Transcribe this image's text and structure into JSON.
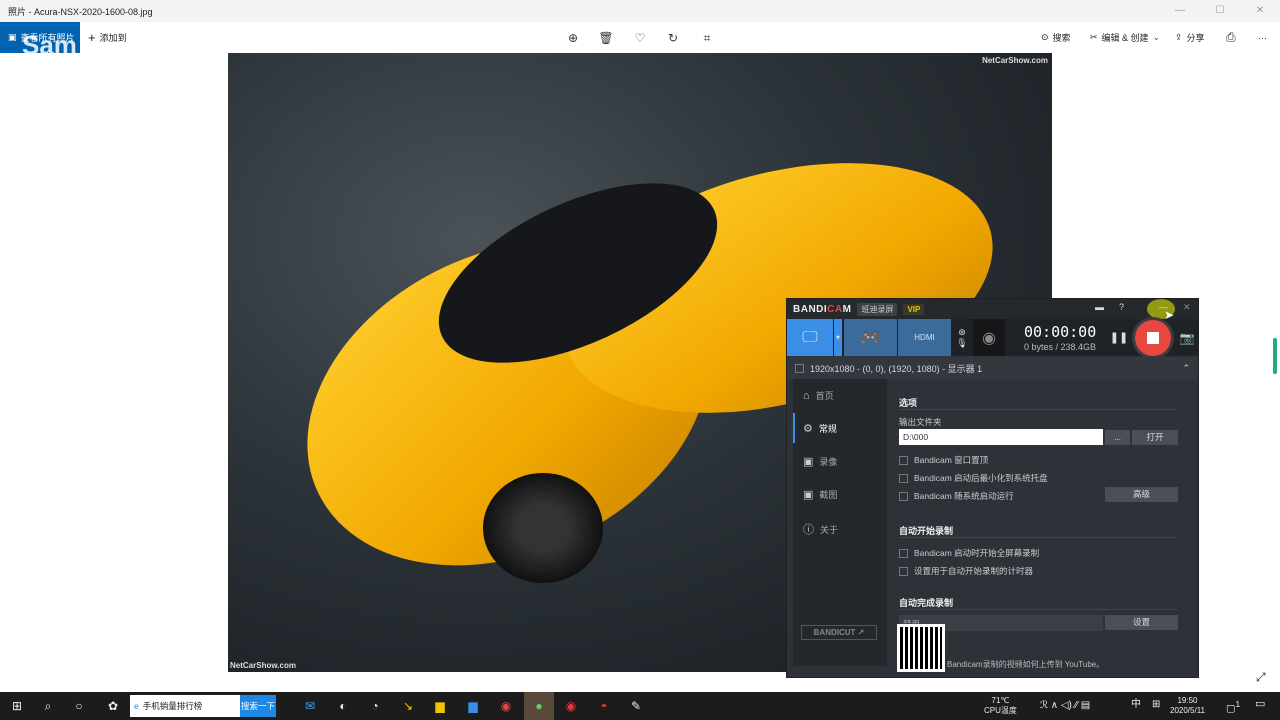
{
  "window": {
    "title": "照片 - Acura-NSX-2020-1600-08.jpg",
    "controls": [
      "—",
      "☐",
      "✕"
    ]
  },
  "toolbar": {
    "see_all": "查看所有照片",
    "add_to": "添加到",
    "search": "搜索",
    "edit_create": "编辑 & 创建",
    "share": "分享",
    "more": "···"
  },
  "overlay_watermark": "Sam",
  "photo": {
    "watermark_top": "NetCarShow.com",
    "watermark_bottom": "NetCarShow.com"
  },
  "bandicam": {
    "brand": "BANDICAM",
    "brand_sub": "班迪录屏",
    "vip": "VIP",
    "title_icons": [
      "▬",
      "?",
      "—",
      "✕"
    ],
    "timer": "00:00:00",
    "size": "0 bytes / 238.4GB",
    "area": "1920x1080 - (0, 0), (1920, 1080) - 显示器 1",
    "hdmi": "HDMI",
    "sidebar": [
      {
        "icon": "⌂",
        "label": "首页"
      },
      {
        "icon": "⚙",
        "label": "常规"
      },
      {
        "icon": "▣",
        "label": "录像"
      },
      {
        "icon": "▣",
        "label": "截图"
      },
      {
        "icon": "ⓘ",
        "label": "关于"
      }
    ],
    "options_title": "选项",
    "output_folder_label": "输出文件夹",
    "output_folder": "D:\\000",
    "browse": "...",
    "open": "打开",
    "checks": [
      "Bandicam 窗口置顶",
      "Bandicam 启动后最小化到系统托盘",
      "Bandicam 随系统启动运行"
    ],
    "advanced": "高级",
    "auto_start_title": "自动开始录制",
    "auto_start_checks": [
      "Bandicam 启动时开始全屏幕录制",
      "设置用于自动开始录制的计时器"
    ],
    "auto_finish_title": "自动完成录制",
    "auto_finish_value": "禁用",
    "settings": "设置",
    "bandicut": "BANDICUT ↗",
    "footer": "Bandicam录制的视频如何上传到 YouTube。"
  },
  "taskbar": {
    "search_text": "手机销量排行榜",
    "search_btn": "搜索一下",
    "temp": "71℃",
    "temp_label": "CPU温度",
    "ime": "中",
    "time": "19:50",
    "date": "2020/5/11",
    "notif": "1"
  }
}
